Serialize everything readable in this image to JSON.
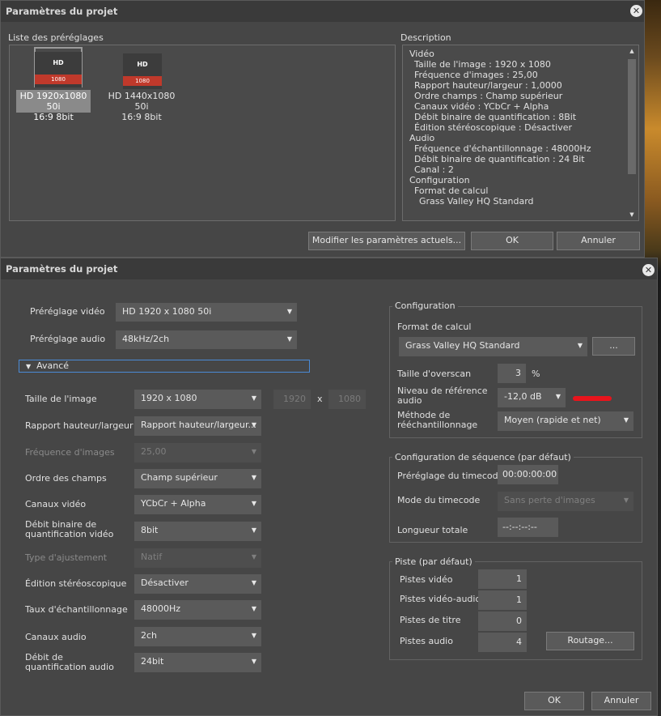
{
  "top_window": {
    "title": "Paramètres du projet",
    "presets_label": "Liste des préréglages",
    "presets": [
      {
        "badge": "HD",
        "res": "1080",
        "line1": "HD 1920x1080 50i",
        "line2": "16:9 8bit"
      },
      {
        "badge": "HD",
        "res": "1080",
        "line1": "HD 1440x1080 50i",
        "line2": "16:9 8bit"
      }
    ],
    "description_label": "Description",
    "description_lines": [
      "Vidéo",
      "Taille de l'image : 1920 x 1080",
      "Fréquence d'images : 25,00",
      "Rapport hauteur/largeur : 1,0000",
      "Ordre champs : Champ supérieur",
      "Canaux vidéo : YCbCr + Alpha",
      "Débit binaire de quantification :  8Bit",
      "Édition stéréoscopique : Désactiver",
      "Audio",
      "Fréquence d'échantillonnage : 48000Hz",
      "Débit binaire de quantification : 24 Bit",
      "Canal : 2",
      "Configuration",
      "Format de calcul",
      "Grass Valley HQ Standard"
    ],
    "modify_button": "Modifier les paramètres actuels...",
    "ok_button": "OK",
    "cancel_button": "Annuler"
  },
  "main_window": {
    "title": "Paramètres du projet",
    "video_preset_label": "Préréglage vidéo",
    "video_preset_value": "HD 1920 x 1080 50i",
    "audio_preset_label": "Préréglage audio",
    "audio_preset_value": "48kHz/2ch",
    "advanced_label": "Avancé",
    "image_size_label": "Taille de l'image",
    "image_size_value": "1920 x 1080",
    "width_value": "1920",
    "x_label": "x",
    "height_value": "1080",
    "aspect_label": "Rapport hauteur/largeur",
    "aspect_value": "Rapport hauteur/largeur...",
    "framerate_label": "Fréquence d'images",
    "framerate_value": "25,00",
    "field_order_label": "Ordre des champs",
    "field_order_value": "Champ supérieur",
    "video_channels_label": "Canaux vidéo",
    "video_channels_value": "YCbCr + Alpha",
    "video_bitdepth_label": "Débit binaire de quantification vidéo",
    "video_bitdepth_value": "8bit",
    "adjust_type_label": "Type d'ajustement",
    "adjust_type_value": "Natif",
    "stereo_label": "Édition stéréoscopique",
    "stereo_value": "Désactiver",
    "samplerate_label": "Taux d'échantillonnage",
    "samplerate_value": "48000Hz",
    "audio_channels_label": "Canaux audio",
    "audio_channels_value": "2ch",
    "audio_bitdepth_label": "Débit de quantification audio",
    "audio_bitdepth_value": "24bit",
    "config_group": "Configuration",
    "render_format_label": "Format de calcul",
    "render_format_value": "Grass Valley HQ Standard",
    "render_format_more": "...",
    "overscan_label": "Taille d'overscan",
    "overscan_value": "3",
    "overscan_unit": "%",
    "ref_level_label": "Niveau de référence audio",
    "ref_level_value": "-12,0 dB",
    "ref_level_color": "#e8141c",
    "resample_label": "Méthode de rééchantillonnage",
    "resample_value": "Moyen (rapide et net)",
    "sequence_group": "Configuration de séquence (par défaut)",
    "tc_preset_label": "Préréglage du timecode",
    "tc_preset_value": "00:00:00:00",
    "tc_mode_label": "Mode du timecode",
    "tc_mode_value": "Sans perte d'images",
    "total_length_label": "Longueur totale",
    "total_length_value": "--:--:--:--",
    "track_group": "Piste (par défaut)",
    "video_tracks_label": "Pistes vidéo",
    "video_tracks_value": "1",
    "va_tracks_label": "Pistes vidéo-audio",
    "va_tracks_value": "1",
    "title_tracks_label": "Pistes de titre",
    "title_tracks_value": "0",
    "audio_tracks_label": "Pistes audio",
    "audio_tracks_value": "4",
    "routing_button": "Routage...",
    "ok_button": "OK",
    "cancel_button": "Annuler"
  }
}
